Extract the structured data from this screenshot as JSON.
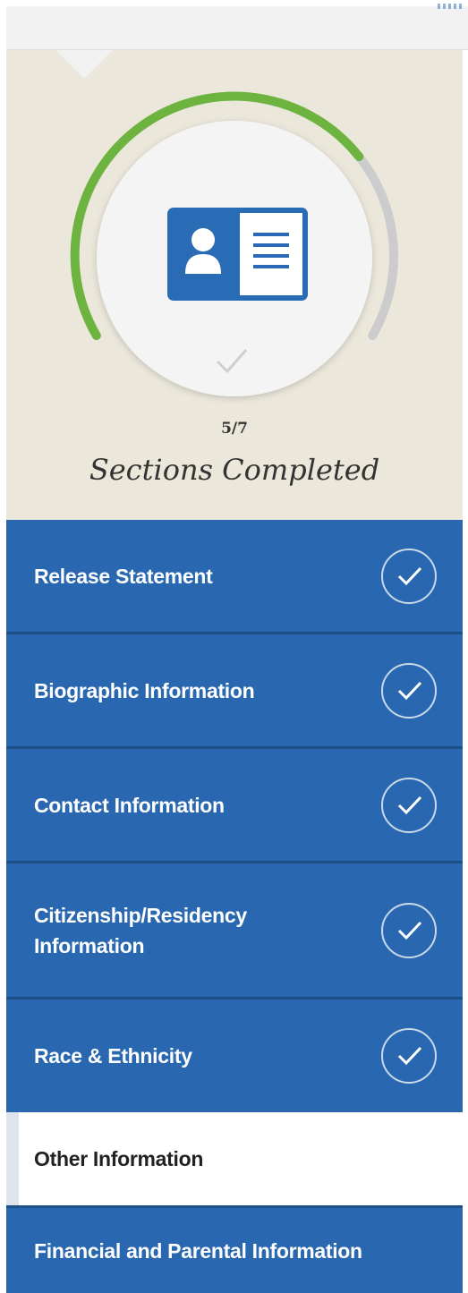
{
  "progress": {
    "completed": 5,
    "total": 7,
    "count_text": "5/7",
    "label": "Sections Completed",
    "icon": "id-card-icon",
    "status_icon": "checkmark-icon"
  },
  "colors": {
    "ring_complete": "#6cb33f",
    "ring_remaining": "#cccccc",
    "nav_bg": "#2968b0",
    "panel_bg": "#ebe7db",
    "icon_blue": "#2a6bb5"
  },
  "nav": {
    "items": [
      {
        "label": "Release Statement",
        "completed": true
      },
      {
        "label": "Biographic Information",
        "completed": true
      },
      {
        "label": "Contact Information",
        "completed": true
      },
      {
        "label": "Citizenship/Residency Information",
        "completed": true
      },
      {
        "label": "Race & Ethnicity",
        "completed": true
      },
      {
        "label": "Other Information",
        "completed": false,
        "active": true
      },
      {
        "label": "Financial and Parental Information",
        "completed": false
      }
    ]
  }
}
